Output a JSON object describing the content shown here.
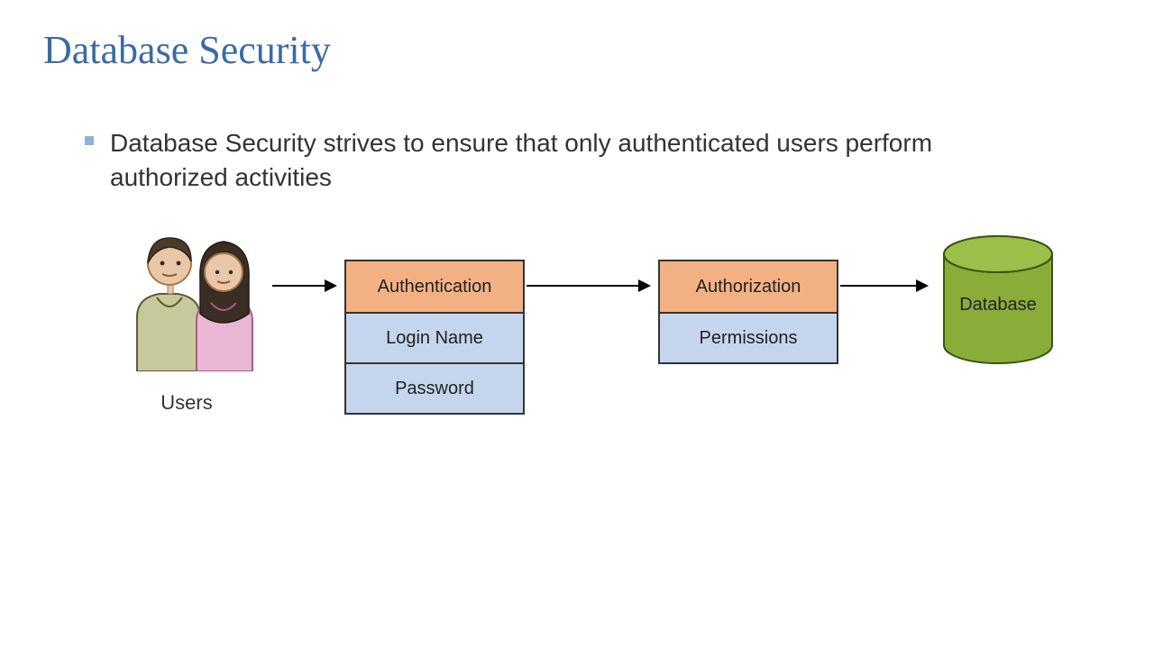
{
  "title": "Database Security",
  "bullet": "Database Security strives to ensure that only authenticated users perform authorized activities",
  "diagram": {
    "users_label": "Users",
    "auth_box": {
      "header": "Authentication",
      "rows": [
        "Login Name",
        "Password"
      ]
    },
    "authz_box": {
      "header": "Authorization",
      "rows": [
        "Permissions"
      ]
    },
    "database_label": "Database",
    "flow": [
      "Users",
      "Authentication",
      "Authorization",
      "Database"
    ]
  }
}
